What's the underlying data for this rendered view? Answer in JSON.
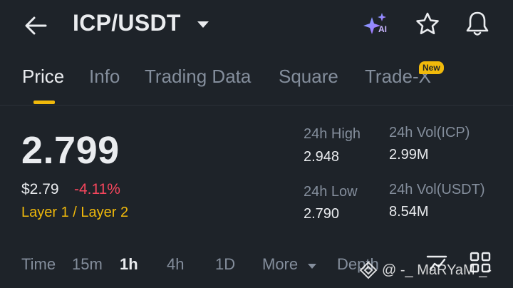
{
  "header": {
    "pair": "ICP/USDT",
    "icons": {
      "back": "arrow-left-icon",
      "pair_dropdown": "caret-down-icon",
      "ai": "ai-sparkle-icon",
      "favorite": "star-icon",
      "alerts": "bell-icon"
    },
    "ai_label": "AI"
  },
  "tabs": [
    {
      "label": "Price",
      "active": true
    },
    {
      "label": "Info",
      "active": false
    },
    {
      "label": "Trading Data",
      "active": false
    },
    {
      "label": "Square",
      "active": false
    },
    {
      "label": "Trade-X",
      "active": false,
      "badge": "New"
    }
  ],
  "price": {
    "last": "2.799",
    "usd": "$2.79",
    "change_pct": "-4.11%",
    "category": "Layer 1 / Layer 2"
  },
  "stats": {
    "high_label": "24h High",
    "high_value": "2.948",
    "low_label": "24h Low",
    "low_value": "2.790",
    "vol_base_label": "24h Vol(ICP)",
    "vol_base_value": "2.99M",
    "vol_quote_label": "24h Vol(USDT)",
    "vol_quote_value": "8.54M"
  },
  "timeframes": {
    "items": [
      "Time",
      "15m",
      "1h",
      "4h",
      "1D"
    ],
    "active": "1h",
    "more": "More",
    "depth": "Depth"
  },
  "watermark": {
    "text": "@ -_ MaRYaM _-"
  },
  "colors": {
    "background": "#1e2329",
    "accent": "#f0b90b",
    "negative": "#f6465d",
    "muted": "#848e9c",
    "text": "#eaecef"
  }
}
